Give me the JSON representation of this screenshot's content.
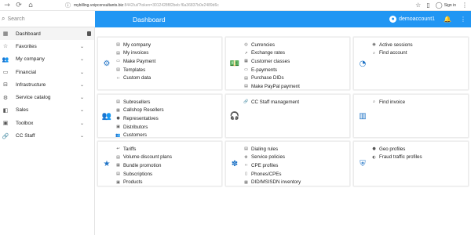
{
  "browser": {
    "nav": [
      "→",
      "⟳",
      "⌂"
    ],
    "url_host": "mybilling.voipconsultants.biz",
    "url_rest": ":8442/ui/?token=3012428f82beb f6a36837b0e2489d6c",
    "sign_in": "Sign in"
  },
  "search": {
    "placeholder": "Search"
  },
  "appbar": {
    "title": "Dashboard",
    "user": "demoaccount1"
  },
  "sidebar": {
    "items": [
      {
        "label": "Dashboard",
        "icon": "grid-icon",
        "glyph": "▦",
        "badge": ""
      },
      {
        "label": "Favorites",
        "icon": "star-icon",
        "glyph": "☆",
        "chevron": "⌄"
      },
      {
        "label": "My company",
        "icon": "people-icon",
        "glyph": "👥",
        "chevron": "⌄"
      },
      {
        "label": "Financial",
        "icon": "card-icon",
        "glyph": "▭",
        "chevron": "⌄"
      },
      {
        "label": "Infrastructure",
        "icon": "hierarchy-icon",
        "glyph": "⊟",
        "chevron": "⌄"
      },
      {
        "label": "Service catalog",
        "icon": "gear-icon",
        "glyph": "⚙",
        "chevron": "⌄"
      },
      {
        "label": "Sales",
        "icon": "toggle-icon",
        "glyph": "◧",
        "chevron": "⌄"
      },
      {
        "label": "Toolbox",
        "icon": "toolbox-icon",
        "glyph": "▣",
        "chevron": "⌄"
      },
      {
        "label": "CC Staff",
        "icon": "link-icon",
        "glyph": "🔗",
        "chevron": "⌄"
      }
    ]
  },
  "cards": [
    {
      "icon": "gear-icon",
      "glyph": "⚙",
      "links": [
        {
          "label": "My company",
          "glyph": "▤"
        },
        {
          "label": "My invoices",
          "glyph": "▤"
        },
        {
          "label": "Make Payment",
          "glyph": "▭"
        },
        {
          "label": "Templates",
          "glyph": "▤"
        },
        {
          "label": "Custom data",
          "glyph": "‹›"
        }
      ]
    },
    {
      "icon": "money-icon",
      "glyph": "💵",
      "links": [
        {
          "label": "Currencies",
          "glyph": "◎"
        },
        {
          "label": "Exchange rates",
          "glyph": "↗"
        },
        {
          "label": "Customer classes",
          "glyph": "▦"
        },
        {
          "label": "E-payments",
          "glyph": "▭"
        },
        {
          "label": "Purchase DIDs",
          "glyph": "▤"
        },
        {
          "label": "Make PayPal payment",
          "glyph": "▤"
        }
      ]
    },
    {
      "icon": "speedometer-icon",
      "glyph": "◔",
      "links": [
        {
          "label": "Active sessions",
          "glyph": "◉"
        },
        {
          "label": "Find account",
          "glyph": "⌕"
        }
      ]
    },
    {
      "icon": "people-icon",
      "glyph": "👥",
      "links": [
        {
          "label": "Subresellers",
          "glyph": "▤"
        },
        {
          "label": "Callshop Resellers",
          "glyph": "▦"
        },
        {
          "label": "Representatives",
          "glyph": "●"
        },
        {
          "label": "Distributors",
          "glyph": "▣"
        },
        {
          "label": "Customers",
          "glyph": "👥"
        }
      ]
    },
    {
      "icon": "headset-icon",
      "glyph": "🎧",
      "links": [
        {
          "label": "CC Staff management",
          "glyph": "🔗"
        }
      ]
    },
    {
      "icon": "invoice-icon",
      "glyph": "▥",
      "links": [
        {
          "label": "Find invoice",
          "glyph": "⌕"
        }
      ]
    },
    {
      "icon": "star-icon",
      "glyph": "★",
      "links": [
        {
          "label": "Tariffs",
          "glyph": "↩"
        },
        {
          "label": "Volume discount plans",
          "glyph": "▤"
        },
        {
          "label": "Bundle promotion",
          "glyph": "▦"
        },
        {
          "label": "Subscriptions",
          "glyph": "▤"
        },
        {
          "label": "Products",
          "glyph": "▣"
        }
      ]
    },
    {
      "icon": "network-icon",
      "glyph": "✽",
      "links": [
        {
          "label": "Dialing rules",
          "glyph": "▤"
        },
        {
          "label": "Service policies",
          "glyph": "⚙"
        },
        {
          "label": "CPE profiles",
          "glyph": "‹›"
        },
        {
          "label": "Phones/CPEs",
          "glyph": "▯"
        },
        {
          "label": "DID/MSISDN inventory",
          "glyph": "▦"
        }
      ]
    },
    {
      "icon": "shield-icon",
      "glyph": "⛨",
      "links": [
        {
          "label": "Geo profiles",
          "glyph": "●"
        },
        {
          "label": "Fraud traffic profiles",
          "glyph": "◐"
        }
      ]
    }
  ],
  "colors": {
    "accent": "#2196f3",
    "icon_blue": "#1f73c6"
  }
}
